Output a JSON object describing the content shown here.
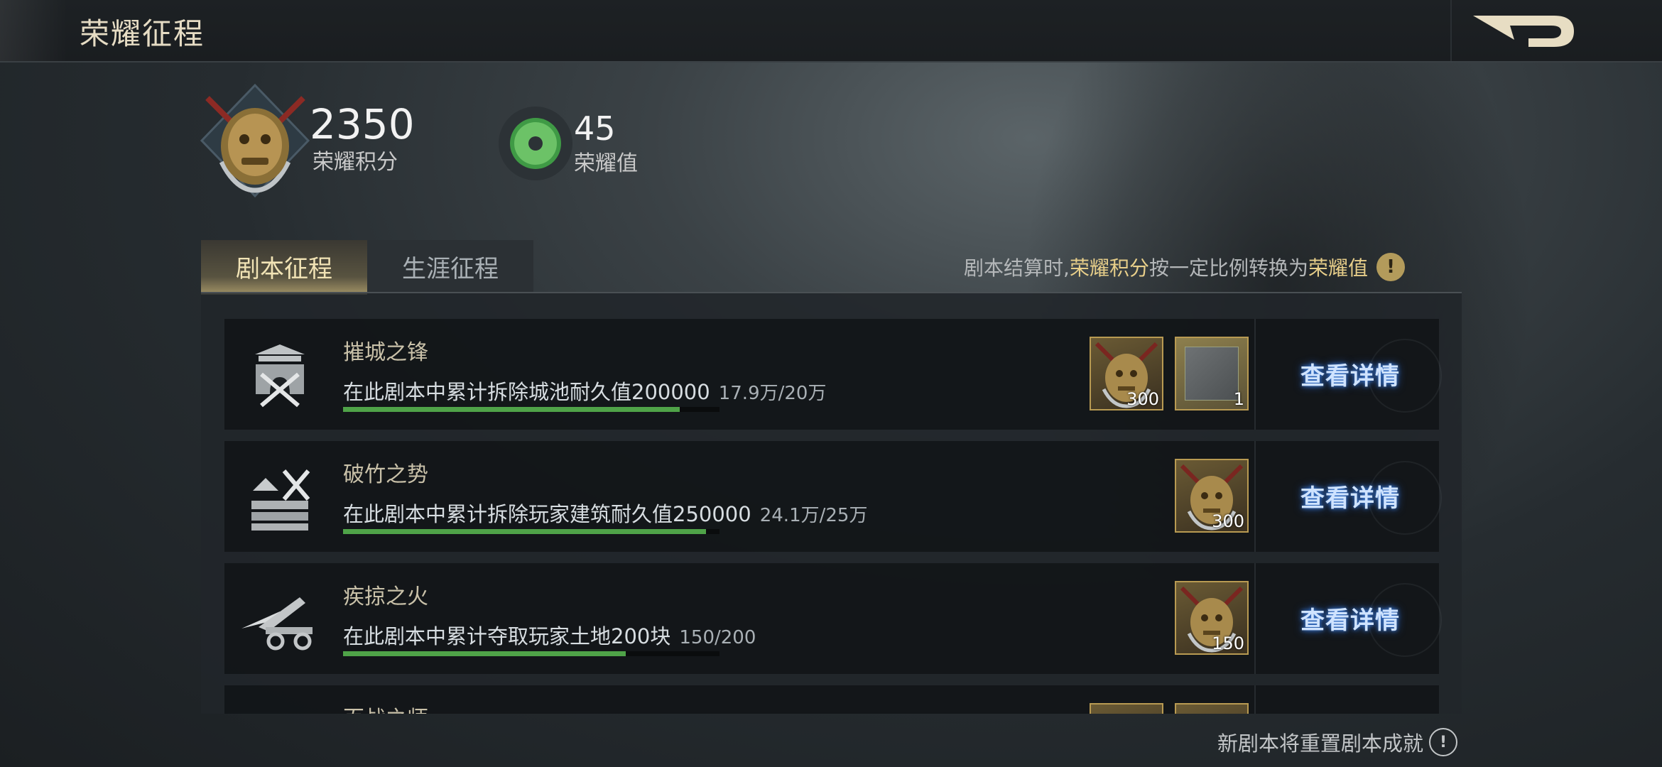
{
  "header": {
    "title": "荣耀征程"
  },
  "summary": {
    "score_value": "2350",
    "score_label": "荣耀积分",
    "honor_value": "45",
    "honor_label": "荣耀值"
  },
  "tabs": [
    {
      "label": "剧本征程",
      "active": true
    },
    {
      "label": "生涯征程",
      "active": false
    }
  ],
  "hint": {
    "prefix": "剧本结算时,",
    "highlight1": "荣耀积分",
    "middle": "按一定比例转换为",
    "highlight2": "荣耀值",
    "icon": "!"
  },
  "achievements": [
    {
      "title": "摧城之锋",
      "desc": "在此剧本中累计拆除城池耐久值200000",
      "progress_text": "17.9万/20万",
      "progress": 0.895,
      "icon": "fortress-swords-icon",
      "rewards": [
        {
          "type": "emblem",
          "count": "300"
        },
        {
          "type": "frame",
          "count": "1"
        }
      ],
      "action": "查看详情"
    },
    {
      "title": "破竹之势",
      "desc": "在此剧本中累计拆除玩家建筑耐久值250000",
      "progress_text": "24.1万/25万",
      "progress": 0.964,
      "icon": "wall-axe-icon",
      "rewards": [
        {
          "type": "emblem",
          "count": "300"
        }
      ],
      "action": "查看详情"
    },
    {
      "title": "疾掠之火",
      "desc": "在此剧本中累计夺取玩家土地200块",
      "progress_text": "150/200",
      "progress": 0.75,
      "icon": "catapult-icon",
      "rewards": [
        {
          "type": "emblem",
          "count": "150"
        }
      ],
      "action": "查看详情"
    },
    {
      "title": "百战之师",
      "desc": "",
      "progress_text": "",
      "progress": 0,
      "icon": "partial-icon",
      "rewards": [
        {
          "type": "emblem",
          "count": ""
        },
        {
          "type": "emblem",
          "count": ""
        }
      ],
      "action": ""
    }
  ],
  "footer": {
    "text": "新剧本将重置剧本成就",
    "icon": "!"
  },
  "colors": {
    "accent_gold": "#e8cf8a",
    "progress_green": "#4fa348",
    "button_glow": "#3b7bd6"
  }
}
